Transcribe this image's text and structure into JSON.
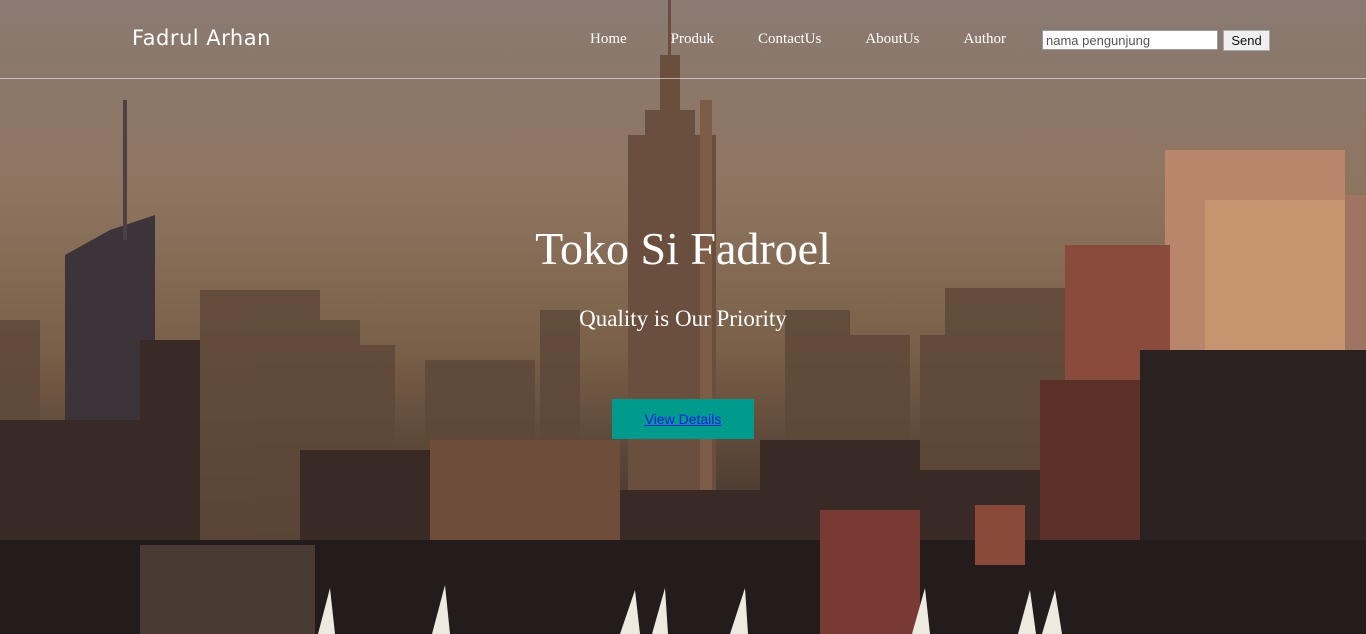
{
  "header": {
    "brand": "Fadrul Arhan",
    "nav": [
      "Home",
      "Produk",
      "ContactUs",
      "AboutUs",
      "Author"
    ],
    "search_placeholder": "nama pengunjung",
    "send_label": "Send"
  },
  "hero": {
    "title": "Toko Si Fadroel",
    "subtitle": "Quality is Our Priority",
    "cta_label": "View Details",
    "cta_color": "#009b8d",
    "background_description_colors": [
      "#8a7a72",
      "#7a6048",
      "#2a2220"
    ]
  }
}
